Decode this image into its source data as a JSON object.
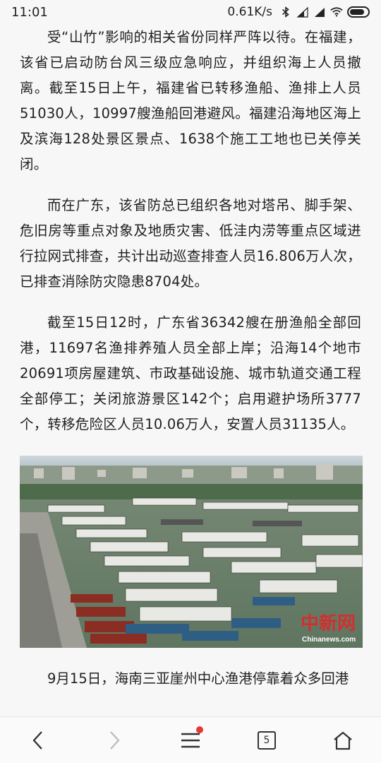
{
  "status_bar": {
    "time": "11:01",
    "network_speed": "0.61K/s",
    "icons": [
      "bluetooth-icon",
      "signal-icon",
      "signal-icon",
      "wifi-icon",
      "battery-icon"
    ]
  },
  "article": {
    "paragraphs": [
      "受“山竹”影响的相关省份同样严阵以待。在福建，该省已启动防台风三级应急响应，并组织海上人员撤离。截至15日上午，福建省已转移渔船、渔排上人员51030人，10997艘渔船回港避风。福建沿海地区海上及滨海128处景区景点、1638个施工工地也已关停关闭。",
      "而在广东，该省防总已组织各地对塔吊、脚手架、危旧房等重点对象及地质灾害、低洼内涝等重点区域进行拉网式排查，共计出动巡查排查人员16.806万人次，已排查消除防灾隐患8704处。",
      "截至15日12时，广东省36342艘在册渔船全部回港，11697名渔排养殖人员全部上岸；沿海14个地市20691项房屋建筑、市政基础设施、城市轨道交通工程全部停工；关闭旅游景区142个；启用避护场所3777个，转移危险区人员10.06万人，安置人员31135人。"
    ],
    "photo": {
      "watermark_cn": "中新网",
      "watermark_url": "Chinanews.com"
    },
    "caption": "9月15日，海南三亚崖州中心渔港停靠着众多回港"
  },
  "bottom_nav": {
    "tab_count": "5",
    "icons": [
      "back-icon",
      "forward-icon",
      "menu-icon",
      "tabs-icon",
      "home-icon"
    ]
  },
  "colors": {
    "background": "#f7f7f7",
    "text": "#1f1f1f",
    "notification_dot": "#e53935"
  }
}
